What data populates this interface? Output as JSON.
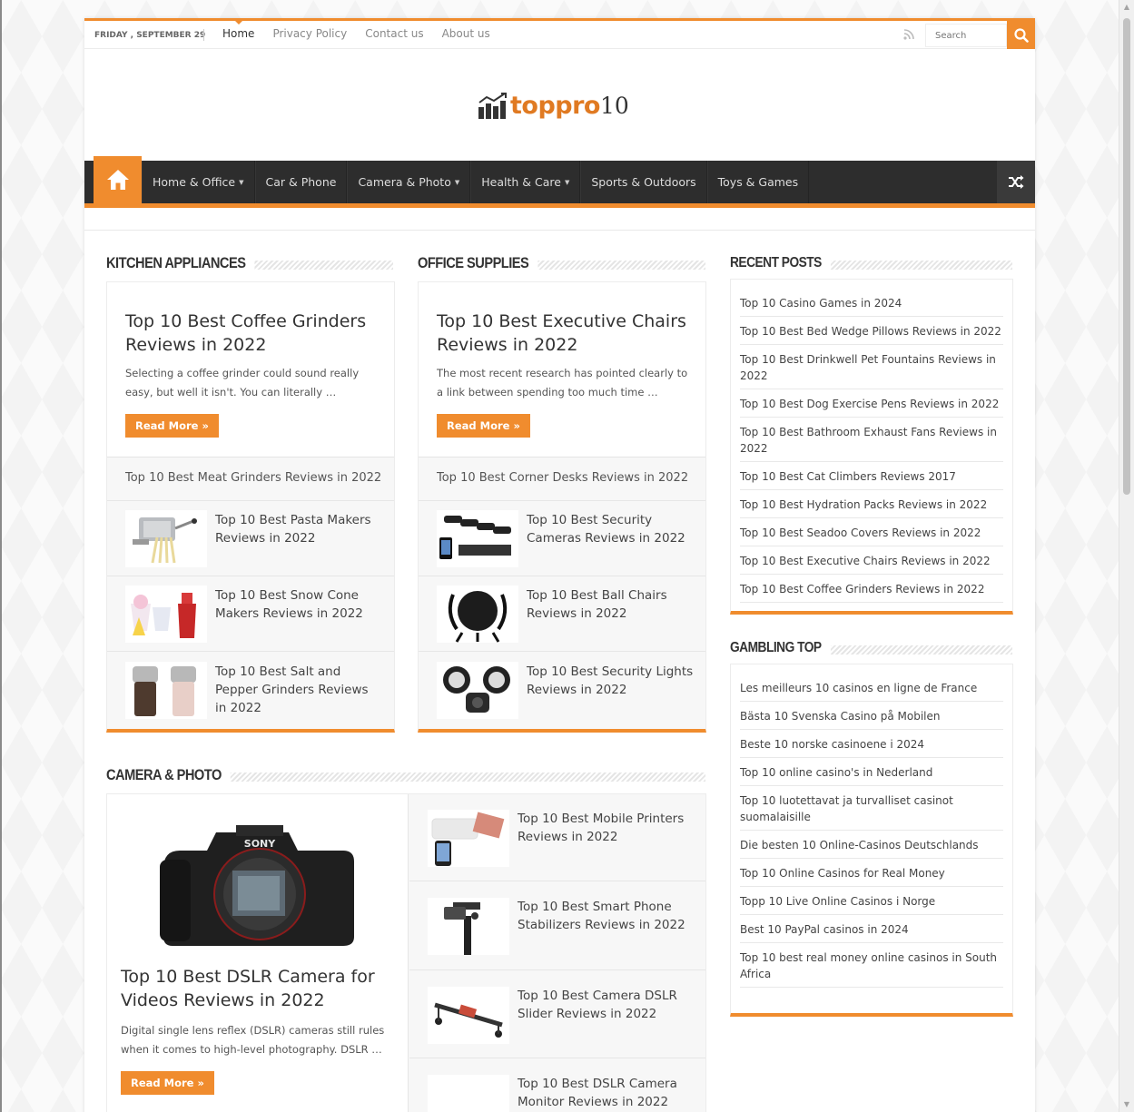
{
  "topbar": {
    "date": "FRIDAY , SEPTEMBER 29",
    "links": [
      "Home",
      "Privacy Policy",
      "Contact us",
      "About us"
    ],
    "search_placeholder": "Search"
  },
  "logo": {
    "text": "toppro",
    "num": "10"
  },
  "nav": {
    "items": [
      {
        "label": "Home & Office",
        "caret": true
      },
      {
        "label": "Car & Phone",
        "caret": false
      },
      {
        "label": "Camera & Photo",
        "caret": true
      },
      {
        "label": "Health & Care",
        "caret": true
      },
      {
        "label": "Sports & Outdoors",
        "caret": false
      },
      {
        "label": "Toys & Games",
        "caret": false
      }
    ]
  },
  "kitchen": {
    "title": "KITCHEN APPLIANCES",
    "featured_title": "Top 10 Best Coffee Grinders Reviews in 2022",
    "excerpt": "Selecting a coffee grinder could sound really easy, but well it isn't. You can literally …",
    "read_more": "Read More »",
    "plain_item": "Top 10 Best Meat Grinders Reviews in 2022",
    "items": [
      "Top 10 Best Pasta Makers Reviews in 2022",
      "Top 10 Best Snow Cone Makers Reviews in 2022",
      "Top 10 Best Salt and Pepper Grinders Reviews in 2022"
    ]
  },
  "office": {
    "title": "OFFICE SUPPLIES",
    "featured_title": "Top 10 Best Executive Chairs Reviews in 2022",
    "excerpt": "The most recent research has pointed clearly to a link between spending too much time …",
    "read_more": "Read More »",
    "plain_item": "Top 10 Best Corner Desks Reviews in 2022",
    "items": [
      "Top 10 Best Security Cameras Reviews in 2022",
      "Top 10 Best Ball Chairs Reviews in 2022",
      "Top 10 Best Security Lights Reviews in 2022"
    ]
  },
  "camera": {
    "title": "CAMERA & PHOTO",
    "camera_brand": "SONY",
    "featured_title": "Top 10 Best DSLR Camera for Videos Reviews in 2022",
    "excerpt": "Digital single lens reflex (DSLR) cameras still rules when it comes to high-level photography. DSLR …",
    "read_more": "Read More »",
    "items": [
      "Top 10 Best Mobile Printers Reviews in 2022",
      "Top 10 Best Smart Phone Stabilizers Reviews in 2022",
      "Top 10 Best Camera DSLR Slider Reviews in 2022",
      "Top 10 Best DSLR Camera Monitor Reviews in 2022"
    ]
  },
  "recent": {
    "title": "RECENT POSTS",
    "items": [
      "Top 10 Casino Games in 2024",
      "Top 10 Best Bed Wedge Pillows Reviews in 2022",
      "Top 10 Best Drinkwell Pet Fountains Reviews in 2022",
      "Top 10 Best Dog Exercise Pens Reviews in 2022",
      "Top 10 Best Bathroom Exhaust Fans Reviews in 2022",
      "Top 10 Best Cat Climbers Reviews 2017",
      "Top 10 Best Hydration Packs Reviews in 2022",
      "Top 10 Best Seadoo Covers Reviews in 2022",
      "Top 10 Best Executive Chairs Reviews in 2022",
      "Top 10 Best Coffee Grinders Reviews in 2022"
    ]
  },
  "gambling": {
    "title": "GAMBLING TOP",
    "items": [
      "Les meilleurs 10 casinos en ligne de France",
      "Bästa 10 Svenska Casino på Mobilen",
      "Beste 10 norske casinoene i 2024",
      "Top 10 online casino's in Nederland",
      "Top 10 luotettavat ja turvalliset casinot suomalaisille",
      "Die besten 10 Online-Casinos Deutschlands",
      "Top 10 Online Casinos for Real Money",
      "Topp 10 Live Online Casinos i Norge",
      "Best 10 PayPal casinos in 2024",
      "Top 10 best real money online casinos in South Africa"
    ]
  },
  "colors": {
    "accent": "#f08c2e",
    "nav_bg": "#2d2d2d"
  }
}
